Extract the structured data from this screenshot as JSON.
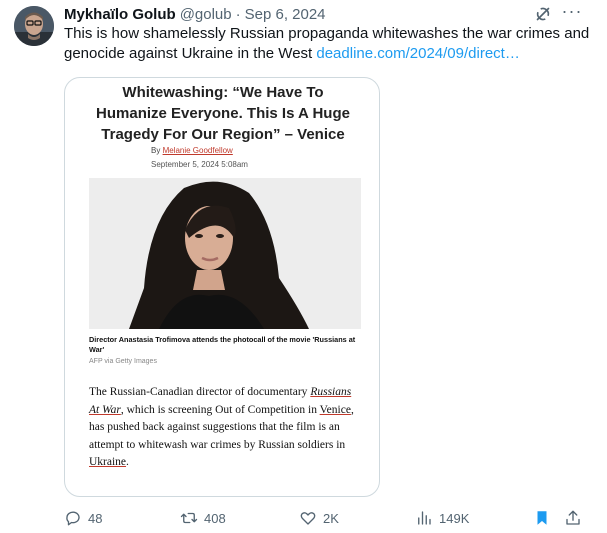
{
  "post": {
    "author_name": "Mykhaïlo Golub",
    "handle": "@golub",
    "separator": "·",
    "date": "Sep 6, 2024",
    "text": "This is how shamelessly Russian propaganda whitewashes the war crimes and genocide against Ukraine in the West ",
    "link_text": "deadline.com/2024/09/direct…"
  },
  "article": {
    "headline": "Whitewashing: “We Have To Humanize Everyone. This Is A Huge Tragedy For Our Region” – Venice",
    "byline_prefix": "By ",
    "author": "Melanie Goodfellow",
    "date": "September 5, 2024 5:08am",
    "caption": "Director Anastasia Trofimova attends the photocall of the movie 'Russians at War'",
    "credit": "AFP via Getty Images",
    "body_1": "The Russian-Canadian director of documentary ",
    "body_film": "Russians At War",
    "body_2": ", which is screening Out of Competition in ",
    "body_venice": "Venice",
    "body_3": ", has pushed back against suggestions that the film is an attempt to whitewash war crimes by Russian soldiers in ",
    "body_ukraine": "Ukraine",
    "body_4": "."
  },
  "actions": {
    "replies": "48",
    "reposts": "408",
    "likes": "2K",
    "views": "149K"
  },
  "colors": {
    "accent": "#1d9bf0",
    "muted": "#536471",
    "border": "#cfd9de"
  },
  "icons": [
    "grok-icon",
    "more-icon",
    "reply-icon",
    "repost-icon",
    "like-icon",
    "views-icon",
    "bookmark-icon",
    "share-icon"
  ]
}
